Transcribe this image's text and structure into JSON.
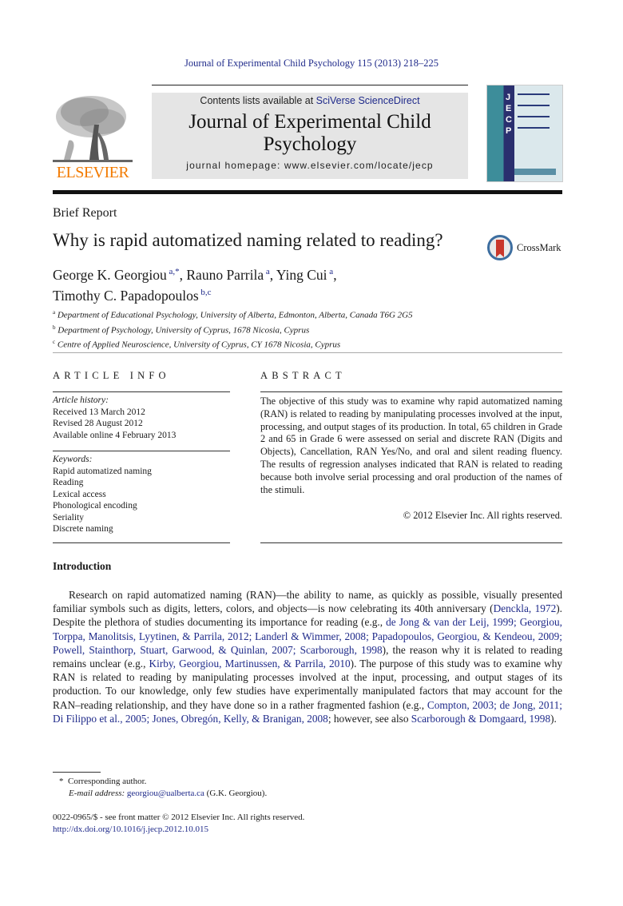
{
  "header": {
    "journal_reference": "Journal of Experimental Child Psychology 115 (2013) 218–225",
    "publisher_logo_text": "ELSEVIER",
    "contents_prefix": "Contents lists available at ",
    "contents_link": "SciVerse ScienceDirect",
    "journal_name": "Journal of Experimental Child Psychology",
    "homepage_line": "journal homepage: www.elsevier.com/locate/jecp",
    "cover": {
      "letters": [
        "J",
        "E",
        "C",
        "P"
      ]
    },
    "colors": {
      "link": "#1f2a8a",
      "elsevier_orange": "#f27a00",
      "masthead_bg": "#e5e5e5"
    }
  },
  "article": {
    "type": "Brief Report",
    "title": "Why is rapid automatized naming related to reading?",
    "crossmark_label": "CrossMark",
    "authors": [
      {
        "name": "George K. Georgiou",
        "aff": "a,*",
        "sep": ", "
      },
      {
        "name": "Rauno Parrila",
        "aff": "a",
        "sep": ", "
      },
      {
        "name": "Ying Cui",
        "aff": "a",
        "sep": ","
      },
      {
        "name": "Timothy C. Papadopoulos",
        "aff": "b,c",
        "sep": ""
      }
    ],
    "affiliations": [
      {
        "key": "a",
        "text": "Department of Educational Psychology, University of Alberta, Edmonton, Alberta, Canada T6G 2G5"
      },
      {
        "key": "b",
        "text": "Department of Psychology, University of Cyprus, 1678 Nicosia, Cyprus"
      },
      {
        "key": "c",
        "text": "Centre of Applied Neuroscience, University of Cyprus, CY 1678 Nicosia, Cyprus"
      }
    ]
  },
  "article_info": {
    "heading": "ARTICLE INFO",
    "history_label": "Article history:",
    "history": [
      "Received 13 March 2012",
      "Revised 28 August 2012",
      "Available online 4 February 2013"
    ],
    "keywords_label": "Keywords:",
    "keywords": [
      "Rapid automatized naming",
      "Reading",
      "Lexical access",
      "Phonological encoding",
      "Seriality",
      "Discrete naming"
    ]
  },
  "abstract": {
    "heading": "ABSTRACT",
    "text": "The objective of this study was to examine why rapid automatized naming (RAN) is related to reading by manipulating processes involved at the input, processing, and output stages of its production. In total, 65 children in Grade 2 and 65 in Grade 6 were assessed on serial and discrete RAN (Digits and Objects), Cancellation, RAN Yes/No, and oral and silent reading fluency. The results of regression analyses indicated that RAN is related to reading because both involve serial processing and oral production of the names of the stimuli.",
    "copyright": "© 2012 Elsevier Inc. All rights reserved."
  },
  "introduction": {
    "heading": "Introduction",
    "segments": [
      {
        "t": "Research on rapid automatized naming (RAN)—the ability to name, as quickly as possible, visually presented familiar symbols such as digits, letters, colors, and objects—is now celebrating its 40th anniversary (",
        "link": false
      },
      {
        "t": "Denckla, 1972",
        "link": true
      },
      {
        "t": "). Despite the plethora of studies documenting its importance for reading (e.g., ",
        "link": false
      },
      {
        "t": "de Jong & van der Leij, 1999; Georgiou, Torppa, Manolitsis, Lyytinen, & Parrila, 2012; Landerl & Wimmer, 2008; Papadopoulos, Georgiou, & Kendeou, 2009; Powell, Stainthorp, Stuart, Garwood, & Quinlan, 2007; Scarborough, 1998",
        "link": true
      },
      {
        "t": "), the reason why it is related to reading remains unclear (e.g., ",
        "link": false
      },
      {
        "t": "Kirby, Georgiou, Martinussen, & Parrila, 2010",
        "link": true
      },
      {
        "t": "). The purpose of this study was to examine why RAN is related to reading by manipulating processes involved at the input, processing, and output stages of its production. To our knowledge, only few studies have experimentally manipulated factors that may account for the RAN–reading relationship, and they have done so in a rather fragmented fashion (e.g., ",
        "link": false
      },
      {
        "t": "Compton, 2003; de Jong, 2011; Di Filippo et al., 2005; Jones, Obregón, Kelly, & Branigan, 2008",
        "link": true
      },
      {
        "t": "; however, see also ",
        "link": false
      },
      {
        "t": "Scarborough & Domgaard, 1998",
        "link": true
      },
      {
        "t": ").",
        "link": false
      }
    ]
  },
  "footnotes": {
    "corresponding_marker": "*",
    "corresponding_text": "Corresponding author.",
    "email_label": "E-mail address:",
    "email": "georgiou@ualberta.ca",
    "email_suffix": " (G.K. Georgiou).",
    "front_matter": "0022-0965/$ - see front matter © 2012 Elsevier Inc. All rights reserved.",
    "doi": "http://dx.doi.org/10.1016/j.jecp.2012.10.015"
  }
}
